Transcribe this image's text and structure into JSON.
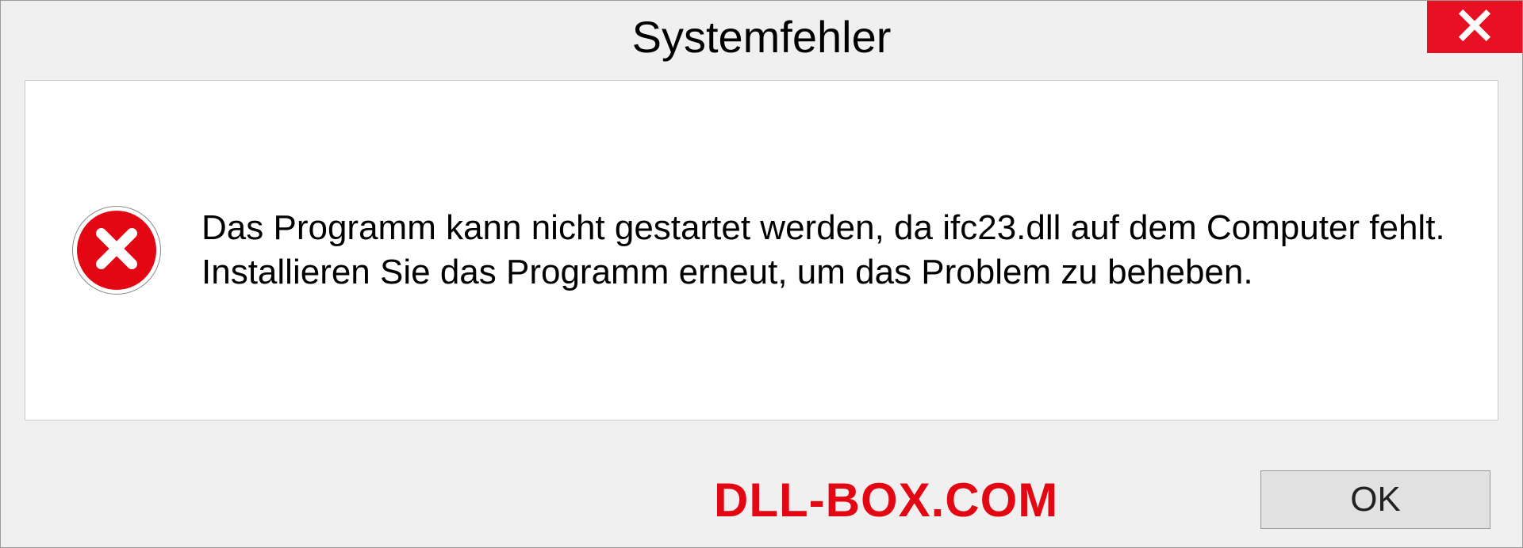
{
  "dialog": {
    "title": "Systemfehler",
    "message": "Das Programm kann nicht gestartet werden, da ifc23.dll auf dem Computer fehlt. Installieren Sie das Programm erneut, um das Problem zu beheben.",
    "ok_label": "OK"
  },
  "watermark": "DLL-BOX.COM",
  "icons": {
    "close": "close-icon",
    "error": "error-cross-icon"
  },
  "colors": {
    "close_bg": "#e81123",
    "error_bg": "#e30613",
    "watermark": "#e30613"
  }
}
